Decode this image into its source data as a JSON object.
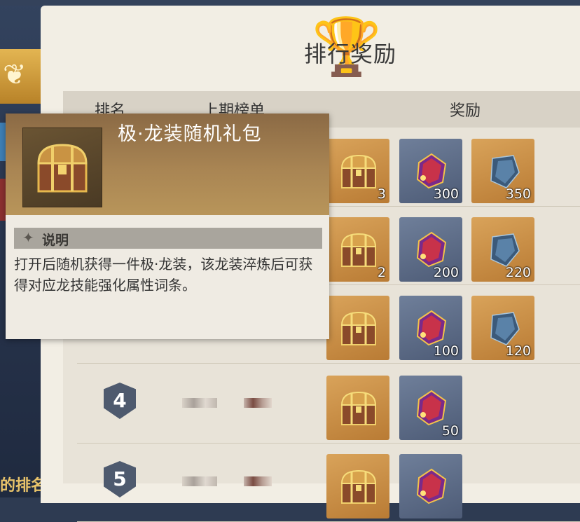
{
  "panel": {
    "title": "排行奖励"
  },
  "table": {
    "headers": {
      "rank": "排名",
      "last_list": "上期榜单",
      "reward": "奖励"
    },
    "rows": [
      {
        "rank": "",
        "rewards": [
          {
            "type": "chest",
            "count": "3"
          },
          {
            "type": "red-gem",
            "count": "300"
          },
          {
            "type": "blue-gem",
            "count": "350"
          }
        ]
      },
      {
        "rank": "",
        "rewards": [
          {
            "type": "chest",
            "count": "2"
          },
          {
            "type": "red-gem",
            "count": "200"
          },
          {
            "type": "blue-gem",
            "count": "220"
          }
        ]
      },
      {
        "rank": "",
        "rewards": [
          {
            "type": "chest",
            "count": ""
          },
          {
            "type": "red-gem",
            "count": "100"
          },
          {
            "type": "blue-gem",
            "count": "120"
          }
        ]
      },
      {
        "rank": "4",
        "rewards": [
          {
            "type": "chest",
            "count": ""
          },
          {
            "type": "red-gem",
            "count": "50"
          }
        ]
      },
      {
        "rank": "5",
        "rewards": [
          {
            "type": "chest",
            "count": ""
          },
          {
            "type": "red-gem",
            "count": ""
          }
        ]
      }
    ]
  },
  "tooltip": {
    "item_name": "极·龙装随机礼包",
    "section_label": "说明",
    "description": "打开后随机获得一件极·龙装，该龙装淬炼后可获得对应龙技能强化属性词条。"
  },
  "sidebar": {
    "bottom_text": "的排名"
  },
  "colors": {
    "gold_tile": "#c8893e",
    "blue_tile": "#5e6c88",
    "panel": "#f2eee4"
  }
}
